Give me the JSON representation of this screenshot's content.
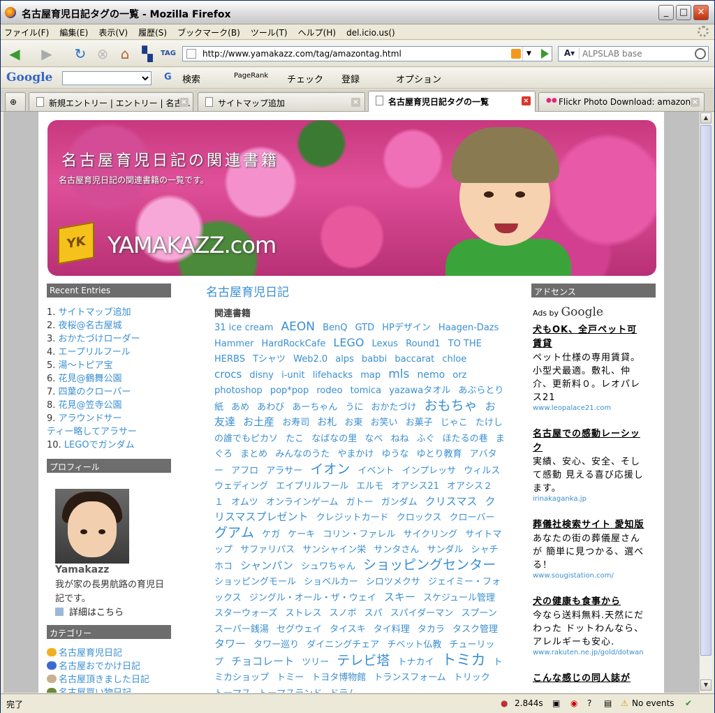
{
  "window": {
    "title": "名古屋育児日記タグの一覧 - Mozilla Firefox"
  },
  "menu": [
    "ファイル(F)",
    "編集(E)",
    "表示(V)",
    "履歴(S)",
    "ブックマーク(B)",
    "ツール(T)",
    "ヘルプ(H)",
    "del.icio.us()"
  ],
  "nav": {
    "url": "http://www.yamakazz.com/tag/amazontag.html",
    "tag_label": "TAG",
    "search_placeholder": "ALPSLAB base"
  },
  "gbar": {
    "logo": "Google",
    "search": "検索",
    "pagerank": "PageRank",
    "check": "チェック",
    "register": "登録",
    "option": "オプション"
  },
  "tabs": [
    {
      "label": "新規エントリー | エントリー | 名古..."
    },
    {
      "label": "サイトマップ追加"
    },
    {
      "label": "名古屋育児日記タグの一覧"
    },
    {
      "label": "Flickr Photo Download: amazon"
    }
  ],
  "banner": {
    "title": "名古屋育児日記の関連書籍",
    "subtitle": "名古屋育児日記の関連書籍の一覧です。",
    "brand": "YAMAKAZZ.com",
    "cube_text": "YK"
  },
  "sidebar": {
    "recent_title": "Recent Entries",
    "recent": [
      {
        "n": "1.",
        "t": "サイトマップ追加"
      },
      {
        "n": "2.",
        "t": "夜桜@名古屋城"
      },
      {
        "n": "3.",
        "t": "おかたづけローダー"
      },
      {
        "n": "4.",
        "t": "エープリルフール"
      },
      {
        "n": "5.",
        "t": "湯～トピア宝"
      },
      {
        "n": "6.",
        "t": "花見@鶴舞公園"
      },
      {
        "n": "7.",
        "t": "四葉のクローバー"
      },
      {
        "n": "8.",
        "t": "花見@笠寺公園"
      },
      {
        "n": "9.",
        "t": "アラウンドサー"
      },
      {
        "n": "",
        "t": "ティー略してアラサー"
      },
      {
        "n": "10.",
        "t": "LEGOでガンダム"
      }
    ],
    "profile_title": "プロフィール",
    "profile_name": "Yamakazz",
    "profile_desc": "我が家の長男航路の育児日記です。",
    "profile_link": "詳細はこちら",
    "category_title": "カテゴリー",
    "categories": [
      "名古屋育児日記",
      "名古屋おでかけ日記",
      "名古屋頂きました日記",
      "名古屋買い物日記"
    ]
  },
  "main": {
    "title": "名古屋育児日記",
    "subtitle": "関連書籍"
  },
  "tags": [
    {
      "t": "31 ice cream",
      "s": 13
    },
    {
      "t": "AEON",
      "s": 17
    },
    {
      "t": "BenQ",
      "s": 13
    },
    {
      "t": "GTD",
      "s": 13
    },
    {
      "t": "HPデザイン",
      "s": 13
    },
    {
      "t": "Haagen-Dazs",
      "s": 13
    },
    {
      "t": "Hammer",
      "s": 13
    },
    {
      "t": "HardRockCafe",
      "s": 13
    },
    {
      "t": "LEGO",
      "s": 16
    },
    {
      "t": "Lexus",
      "s": 13
    },
    {
      "t": "Round1",
      "s": 13
    },
    {
      "t": "TO THE HERBS",
      "s": 13
    },
    {
      "t": "Tシャツ",
      "s": 13
    },
    {
      "t": "Web2.0",
      "s": 13
    },
    {
      "t": "alps",
      "s": 13
    },
    {
      "t": "babbi",
      "s": 13
    },
    {
      "t": "baccarat",
      "s": 13
    },
    {
      "t": "chloe",
      "s": 13
    },
    {
      "t": "crocs",
      "s": 15
    },
    {
      "t": "disny",
      "s": 13
    },
    {
      "t": "i-unit",
      "s": 13
    },
    {
      "t": "lifehacks",
      "s": 13
    },
    {
      "t": "map",
      "s": 13
    },
    {
      "t": "mls",
      "s": 17
    },
    {
      "t": "nemo",
      "s": 14
    },
    {
      "t": "orz",
      "s": 13
    },
    {
      "t": "photoshop",
      "s": 13
    },
    {
      "t": "pop*pop",
      "s": 13
    },
    {
      "t": "rodeo",
      "s": 13
    },
    {
      "t": "tomica",
      "s": 13
    },
    {
      "t": "yazawaタオル",
      "s": 13
    },
    {
      "t": "あぶらとり紙",
      "s": 13
    },
    {
      "t": "あめ",
      "s": 13
    },
    {
      "t": "あわび",
      "s": 13
    },
    {
      "t": "あーちゃん",
      "s": 13
    },
    {
      "t": "うに",
      "s": 13
    },
    {
      "t": "おかたづけ",
      "s": 13
    },
    {
      "t": "おもちゃ",
      "s": 19
    },
    {
      "t": "お友達",
      "s": 15
    },
    {
      "t": "お土産",
      "s": 15
    },
    {
      "t": "お寿司",
      "s": 13
    },
    {
      "t": "お札",
      "s": 14
    },
    {
      "t": "お東",
      "s": 13
    },
    {
      "t": "お笑い",
      "s": 13
    },
    {
      "t": "お菓子",
      "s": 13
    },
    {
      "t": "じゃこ",
      "s": 13
    },
    {
      "t": "たけしの誰でもピカソ",
      "s": 13
    },
    {
      "t": "たこ",
      "s": 13
    },
    {
      "t": "なばなの里",
      "s": 13
    },
    {
      "t": "なべ",
      "s": 13
    },
    {
      "t": "ねね",
      "s": 13
    },
    {
      "t": "ふぐ",
      "s": 13
    },
    {
      "t": "ほたるの巷",
      "s": 13
    },
    {
      "t": "まぐろ",
      "s": 13
    },
    {
      "t": "まとめ",
      "s": 13
    },
    {
      "t": "みんなのうた",
      "s": 13
    },
    {
      "t": "やまかけ",
      "s": 13
    },
    {
      "t": "ゆうな",
      "s": 13
    },
    {
      "t": "ゆとり教育",
      "s": 13
    },
    {
      "t": "アバター",
      "s": 13
    },
    {
      "t": "アフロ",
      "s": 13
    },
    {
      "t": "アラサー",
      "s": 13
    },
    {
      "t": "イオン",
      "s": 19
    },
    {
      "t": "イベント",
      "s": 13
    },
    {
      "t": "インプレッサ",
      "s": 13
    },
    {
      "t": "ウィルス",
      "s": 13
    },
    {
      "t": "ウェディング",
      "s": 13
    },
    {
      "t": "エイプリルフール",
      "s": 13
    },
    {
      "t": "エルモ",
      "s": 13
    },
    {
      "t": "オアシス21",
      "s": 13
    },
    {
      "t": "オアシス２１",
      "s": 13
    },
    {
      "t": "オムツ",
      "s": 13
    },
    {
      "t": "オンラインゲーム",
      "s": 13
    },
    {
      "t": "ガトー",
      "s": 13
    },
    {
      "t": "ガンダム",
      "s": 13
    },
    {
      "t": "クリスマス",
      "s": 15
    },
    {
      "t": "クリスマスプレゼント",
      "s": 15
    },
    {
      "t": "クレジットカード",
      "s": 13
    },
    {
      "t": "クロックス",
      "s": 13
    },
    {
      "t": "クローバー",
      "s": 13
    },
    {
      "t": "グアム",
      "s": 19
    },
    {
      "t": "ケガ",
      "s": 13
    },
    {
      "t": "ケーキ",
      "s": 13
    },
    {
      "t": "コリン・ファレル",
      "s": 13
    },
    {
      "t": "サイクリング",
      "s": 13
    },
    {
      "t": "サイトマップ",
      "s": 13
    },
    {
      "t": "サファリパス",
      "s": 13
    },
    {
      "t": "サンシャイン栄",
      "s": 13
    },
    {
      "t": "サンタさん",
      "s": 13
    },
    {
      "t": "サンダル",
      "s": 13
    },
    {
      "t": "シャチホコ",
      "s": 13
    },
    {
      "t": "シャンパン",
      "s": 15
    },
    {
      "t": "シュワちゃん",
      "s": 13
    },
    {
      "t": "ショッピングセンター",
      "s": 19
    },
    {
      "t": "ショッピングモール",
      "s": 13
    },
    {
      "t": "ショベルカー",
      "s": 13
    },
    {
      "t": "シロツメクサ",
      "s": 13
    },
    {
      "t": "ジェイミー・フォックス",
      "s": 13
    },
    {
      "t": "ジングル・オール・ザ・ウェイ",
      "s": 13
    },
    {
      "t": "スキー",
      "s": 15
    },
    {
      "t": "スケジュール管理",
      "s": 13
    },
    {
      "t": "スターウォーズ",
      "s": 13
    },
    {
      "t": "ストレス",
      "s": 13
    },
    {
      "t": "スノボ",
      "s": 13
    },
    {
      "t": "スパ",
      "s": 13
    },
    {
      "t": "スパイダーマン",
      "s": 13
    },
    {
      "t": "スプーン",
      "s": 13
    },
    {
      "t": "スーパー銭湯",
      "s": 13
    },
    {
      "t": "セグウェイ",
      "s": 13
    },
    {
      "t": "タイスキ",
      "s": 13
    },
    {
      "t": "タイ料理",
      "s": 13
    },
    {
      "t": "タカラ",
      "s": 13
    },
    {
      "t": "タスク管理",
      "s": 13
    },
    {
      "t": "タワー",
      "s": 15
    },
    {
      "t": "タワー巡り",
      "s": 13
    },
    {
      "t": "ダイニングチェア",
      "s": 13
    },
    {
      "t": "チベット仏教",
      "s": 13
    },
    {
      "t": "チューリップ",
      "s": 13
    },
    {
      "t": "チョコレート",
      "s": 15
    },
    {
      "t": "ツリー",
      "s": 13
    },
    {
      "t": "テレビ塔",
      "s": 19
    },
    {
      "t": "トナカイ",
      "s": 13
    },
    {
      "t": "トミカ",
      "s": 21
    },
    {
      "t": "トミカショップ",
      "s": 13
    },
    {
      "t": "トミー",
      "s": 13
    },
    {
      "t": "トヨタ博物館",
      "s": 13
    },
    {
      "t": "トランスフォーム",
      "s": 13
    },
    {
      "t": "トリック",
      "s": 13
    },
    {
      "t": "トーマス",
      "s": 13
    },
    {
      "t": "トーマスランド",
      "s": 13
    },
    {
      "t": "ドラム",
      "s": 13
    }
  ],
  "right": {
    "head": "アドセンス",
    "adsby": "Ads by",
    "adsby_brand": "Google",
    "ads": [
      {
        "title": "犬もOK、全戸ペット可賃貸",
        "body": "ペット仕様の専用賃貸。小型犬最適。敷礼、仲介、更新料０。レオパレス21",
        "url": "www.leopalace21.com"
      },
      {
        "title": "名古屋での感動レーシック",
        "body": "実績、安心、安全、そして感動 見える喜び応援します。",
        "url": "irinakagankа.jp"
      },
      {
        "title": "葬儀社検索サイト 愛知版",
        "body": "あなたの街の葬儀屋さんが 簡単に見つかる、選べる！",
        "url": "www.sougistation.com/"
      },
      {
        "title": "犬の健康も食事から",
        "body": "今なら送料無料.天然にだわった ドットわんなら、アレルギーも安心.",
        "url": "www.rakuten.ne.jp/gold/dotwan"
      },
      {
        "title": "こんな感じの同人誌が",
        "body": "",
        "url": ""
      }
    ]
  },
  "status": {
    "left": "完了",
    "time": "2.844s",
    "events": "No events"
  }
}
